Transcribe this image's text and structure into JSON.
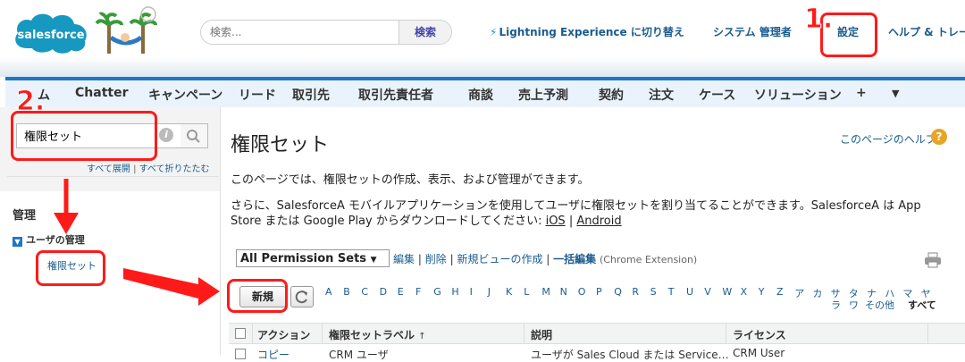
{
  "header": {
    "brand": "salesforce",
    "search_placeholder": "検索...",
    "search_button": "検索",
    "lightning_link": "Lightning Experience に切り替え",
    "user_menu": "システム 管理者",
    "setup_link": "設定",
    "help_link": "ヘルプ & トレー"
  },
  "tabs": [
    "ム",
    "Chatter",
    "キャンペーン",
    "リード",
    "取引先",
    "取引先責任者",
    "商談",
    "売上予測",
    "契約",
    "注文",
    "ケース",
    "ソリューション",
    "+",
    "▼"
  ],
  "sidebar": {
    "quickfind_value": "権限セット",
    "info_icon": "i",
    "expand_all": "すべて展開",
    "collapse_all": "すべて折りたたむ",
    "separator": "|",
    "admin_heading": "管理",
    "user_mgmt": "ユーザの管理",
    "expand_marker": "▼",
    "permission_sets": "権限セット"
  },
  "main": {
    "title": "権限セット",
    "help_page": "このページのヘルプ",
    "help_icon": "?",
    "desc1": "このページでは、権限セットの作成、表示、および管理ができます。",
    "desc2_line1": "さらに、SalesforceA モバイルアプリケーションを使用してユーザに権限セットを割り当てることができます。SalesforceA は App",
    "desc2_line2_a": "Store または Google Play からダウンロードしてください: ",
    "desc2_ios": "iOS",
    "desc2_sep": " | ",
    "desc2_android": "Android",
    "view_select": "All Permission Sets",
    "view_select_arrow": "▼",
    "view_links": {
      "edit": "編集",
      "delete": "削除",
      "new_view": "新規ビューの作成",
      "bulk_edit": "一括編集",
      "ext": "(Chrome Extension)",
      "sep": "|"
    },
    "new_button": "新規",
    "alphabet_row1": [
      "A",
      "B",
      "C",
      "D",
      "E",
      "F",
      "G",
      "H",
      "I",
      "J",
      "K",
      "L",
      "M",
      "N",
      "O",
      "P",
      "Q",
      "R",
      "S",
      "T",
      "U",
      "V",
      "W",
      "X",
      "Y",
      "Z",
      "ア",
      "カ",
      "サ",
      "タ",
      "ナ",
      "ハ",
      "マ",
      "ヤ"
    ],
    "alphabet_row2": [
      "ラ",
      "ワ",
      "その他",
      "すべて"
    ],
    "table": {
      "headers": [
        "アクション",
        "権限セットラベル",
        "説明",
        "ライセンス"
      ],
      "sort_arrow": "↑",
      "first_row": [
        "コピー",
        "CRM ユーザ",
        "ユーザが Sales Cloud または Service…",
        "CRM User"
      ]
    }
  },
  "annotations": {
    "step1": "1.",
    "step2": "2."
  },
  "colors": {
    "accent_blue": "#1e76c8",
    "link_blue": "#1a5c8f",
    "annotation_red": "#ff1a1a",
    "tabbar_bg": "#eaf3fb"
  }
}
